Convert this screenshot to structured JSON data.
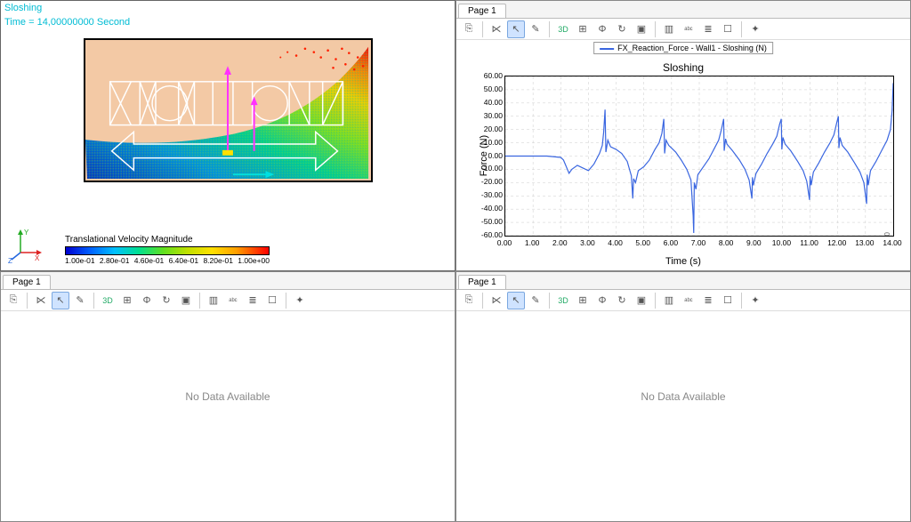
{
  "sim": {
    "title_line1": "Sloshing",
    "title_line2": "Time = 14,00000000 Second",
    "legend_title": "Translational Velocity Magnitude",
    "legend_ticks": [
      "1.00e-01",
      "2.80e-01",
      "4.60e-01",
      "6.40e-01",
      "8.20e-01",
      "1.00e+00"
    ],
    "axis_y": "Y",
    "axis_x": "X",
    "axis_z": "Z"
  },
  "tabs": {
    "page1": "Page 1"
  },
  "toolbar_icons": {
    "copy": "⎘",
    "line": "⋉",
    "cursor": "↖",
    "brush": "✎",
    "td": "3D",
    "axes": "⊞",
    "phi": "Φ",
    "rotate": "↻",
    "layers": "▣",
    "bar": "▥",
    "abc": "ᵃᵇᶜ",
    "list": "≣",
    "box": "☐",
    "wand": "✦"
  },
  "no_data": "No Data Available",
  "chart_data": {
    "type": "line",
    "title": "Sloshing",
    "legend": "FX_Reaction_Force - Wall1 - Sloshing (N)",
    "xlabel": "Time (s)",
    "ylabel": "Force (N)",
    "ylim": [
      -60,
      60
    ],
    "xlim": [
      0,
      14
    ],
    "yticks": [
      -60,
      -50,
      -40,
      -30,
      -20,
      -10,
      0,
      10,
      20,
      30,
      40,
      50,
      60
    ],
    "xticks": [
      0,
      1,
      2,
      3,
      4,
      5,
      6,
      7,
      8,
      9,
      10,
      11,
      12,
      13,
      14
    ],
    "xtick_labels": [
      "0.00",
      "1.00",
      "2.00",
      "3.00",
      "4.00",
      "5.00",
      "6.00",
      "7.00",
      "8.00",
      "9.00",
      "10.00",
      "11.00",
      "12.00",
      "13.00",
      "14.00"
    ],
    "ytick_labels": [
      "-60.00",
      "-50.00",
      "-40.00",
      "-30.00",
      "-20.00",
      "-10.00",
      "0.00",
      "10.00",
      "20.00",
      "30.00",
      "40.00",
      "50.00",
      "60.00"
    ],
    "annotation_x": "14.00",
    "series": [
      {
        "name": "FX_Reaction_Force",
        "color": "#3a66e0",
        "points": [
          [
            0.0,
            0
          ],
          [
            1.0,
            0
          ],
          [
            1.5,
            0
          ],
          [
            2.0,
            -1
          ],
          [
            2.1,
            -3
          ],
          [
            2.3,
            -13
          ],
          [
            2.4,
            -10
          ],
          [
            2.6,
            -7
          ],
          [
            2.8,
            -9
          ],
          [
            3.0,
            -11
          ],
          [
            3.2,
            -6
          ],
          [
            3.4,
            2
          ],
          [
            3.5,
            8
          ],
          [
            3.55,
            18
          ],
          [
            3.6,
            35
          ],
          [
            3.63,
            3
          ],
          [
            3.7,
            12
          ],
          [
            3.8,
            7
          ],
          [
            4.0,
            5
          ],
          [
            4.2,
            2
          ],
          [
            4.4,
            -4
          ],
          [
            4.55,
            -15
          ],
          [
            4.6,
            -32
          ],
          [
            4.63,
            -17
          ],
          [
            4.7,
            -20
          ],
          [
            4.8,
            -11
          ],
          [
            5.0,
            -8
          ],
          [
            5.2,
            -3
          ],
          [
            5.4,
            5
          ],
          [
            5.55,
            10
          ],
          [
            5.65,
            17
          ],
          [
            5.72,
            28
          ],
          [
            5.75,
            2
          ],
          [
            5.8,
            12
          ],
          [
            5.9,
            8
          ],
          [
            6.15,
            3
          ],
          [
            6.35,
            -3
          ],
          [
            6.55,
            -10
          ],
          [
            6.7,
            -18
          ],
          [
            6.78,
            -45
          ],
          [
            6.8,
            -58
          ],
          [
            6.82,
            -20
          ],
          [
            6.88,
            -25
          ],
          [
            6.95,
            -14
          ],
          [
            7.15,
            -8
          ],
          [
            7.35,
            -2
          ],
          [
            7.55,
            6
          ],
          [
            7.7,
            12
          ],
          [
            7.8,
            20
          ],
          [
            7.86,
            26
          ],
          [
            7.88,
            28
          ],
          [
            7.9,
            4
          ],
          [
            7.95,
            13
          ],
          [
            8.0,
            9
          ],
          [
            8.2,
            4
          ],
          [
            8.45,
            -3
          ],
          [
            8.65,
            -10
          ],
          [
            8.8,
            -18
          ],
          [
            8.9,
            -32
          ],
          [
            8.92,
            -16
          ],
          [
            8.95,
            -22
          ],
          [
            9.05,
            -13
          ],
          [
            9.25,
            -6
          ],
          [
            9.45,
            2
          ],
          [
            9.65,
            9
          ],
          [
            9.8,
            15
          ],
          [
            9.9,
            24
          ],
          [
            9.96,
            28
          ],
          [
            9.98,
            5
          ],
          [
            10.02,
            14
          ],
          [
            10.1,
            9
          ],
          [
            10.3,
            4
          ],
          [
            10.55,
            -4
          ],
          [
            10.75,
            -11
          ],
          [
            10.88,
            -19
          ],
          [
            10.98,
            -33
          ],
          [
            11.0,
            -15
          ],
          [
            11.04,
            -22
          ],
          [
            11.12,
            -12
          ],
          [
            11.32,
            -5
          ],
          [
            11.52,
            3
          ],
          [
            11.72,
            10
          ],
          [
            11.86,
            16
          ],
          [
            11.96,
            25
          ],
          [
            12.02,
            30
          ],
          [
            12.04,
            6
          ],
          [
            12.08,
            14
          ],
          [
            12.16,
            8
          ],
          [
            12.36,
            3
          ],
          [
            12.6,
            -5
          ],
          [
            12.8,
            -12
          ],
          [
            12.94,
            -20
          ],
          [
            13.04,
            -36
          ],
          [
            13.06,
            -14
          ],
          [
            13.1,
            -22
          ],
          [
            13.18,
            -11
          ],
          [
            13.38,
            -4
          ],
          [
            13.58,
            4
          ],
          [
            13.78,
            12
          ],
          [
            13.9,
            20
          ],
          [
            13.96,
            34
          ],
          [
            13.99,
            50
          ],
          [
            14.0,
            55
          ]
        ]
      }
    ]
  }
}
